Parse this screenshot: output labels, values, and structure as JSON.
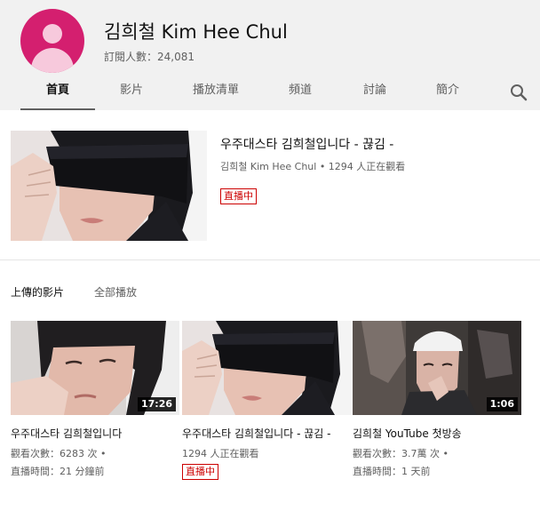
{
  "channel": {
    "name": "김희철 Kim Hee Chul",
    "subscribers": "訂閱人數：24,081"
  },
  "tabs": [
    "首頁",
    "影片",
    "播放清單",
    "頻道",
    "討論",
    "簡介"
  ],
  "featured": {
    "title": "우주대스타 김희철입니다 - 끊김 -",
    "meta": "김희철 Kim Hee Chul • 1294 人正在觀看",
    "badge": "直播中"
  },
  "section": {
    "title": "上傳的影片",
    "play_all": "全部播放"
  },
  "videos": [
    {
      "title": "우주대스타 김희철입니다",
      "duration": "17:26",
      "views": "觀看次數：6283 次 •",
      "time": "直播時間：21 分鐘前"
    },
    {
      "title": "우주대스타 김희철입니다 - 끊김 -",
      "viewers": "1294 人正在觀看",
      "badge": "直播中"
    },
    {
      "title": "김희철 YouTube 첫방송",
      "duration": "1:06",
      "views": "觀看次數：3.7萬 次 •",
      "time": "直播時間：1 天前"
    }
  ],
  "colors": {
    "header_bg": "#f1f1f1",
    "avatar": "#d41f6f",
    "live_red": "#cc0000"
  }
}
